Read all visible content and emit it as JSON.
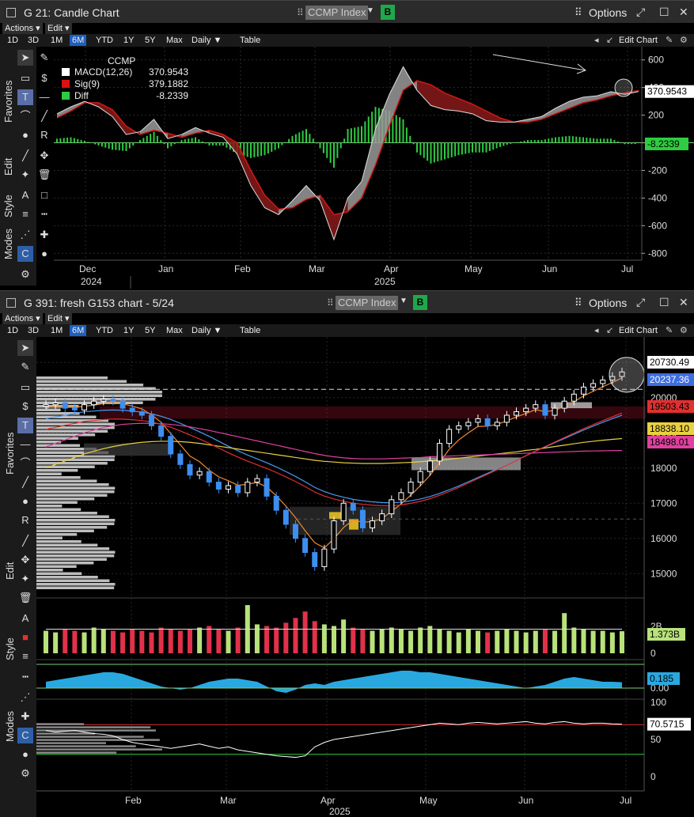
{
  "top_window": {
    "title": "G 21: Candle Chart",
    "security": "CCMP Index",
    "security_button": "B",
    "options_label": "Options",
    "menu": [
      "Actions ▾",
      "Edit ▾"
    ],
    "ranges": [
      "1D",
      "3D",
      "1M",
      "6M",
      "YTD",
      "1Y",
      "5Y",
      "Max",
      "Daily ▼",
      "Table"
    ],
    "selected_range": "6M",
    "edit_chart_label": "Edit Chart",
    "side_labels": [
      "Favorites",
      "Edit",
      "Style",
      "Modes"
    ]
  },
  "bottom_window": {
    "title": "G 391: fresh G153 chart - 5/24",
    "security": "CCMP Index",
    "security_button": "B",
    "options_label": "Options",
    "menu": [
      "Actions ▾",
      "Edit ▾"
    ],
    "ranges": [
      "1D",
      "3D",
      "1M",
      "6M",
      "YTD",
      "1Y",
      "5Y",
      "Max",
      "Daily ▼",
      "Table"
    ],
    "selected_range": "6M",
    "edit_chart_label": "Edit Chart",
    "side_labels": [
      "Favorites",
      "Edit",
      "Style",
      "Modes"
    ]
  },
  "colors": {
    "macd_line": "#ffffff",
    "signal_line": "#d01818",
    "diff_bar": "#2ecc40",
    "ma_red": "#e03030",
    "ma_orange": "#f08a30",
    "ma_blue": "#4a9af0",
    "ma_yellow": "#e8d040",
    "ma_pink": "#e040a0",
    "up_candle": "#ffffff",
    "down_candle": "#3d8ef0",
    "vol_up": "#b8e27a",
    "vol_down": "#e0324a",
    "osc_fill": "#29a8e0",
    "rsi_line": "#ffffff"
  },
  "chart_data": [
    {
      "type": "line",
      "title": "CCMP",
      "legend": [
        {
          "name": "MACD(12,26)",
          "value": "370.9543",
          "color": "#ffffff"
        },
        {
          "name": "Sig(9)",
          "value": "379.1882",
          "color": "#e01010"
        },
        {
          "name": "Diff",
          "value": "-8.2339",
          "color": "#2ecc40"
        }
      ],
      "y_ticks": [
        "600",
        "400",
        "200",
        "0",
        "-200",
        "-400",
        "-600",
        "-800"
      ],
      "ylim": [
        -850,
        650
      ],
      "x_ticks": [
        "Dec",
        "Jan",
        "Feb",
        "Mar",
        "Apr",
        "May",
        "Jun",
        "Jul"
      ],
      "x_years": [
        "2024",
        "2025"
      ],
      "last_labels": [
        "370.9543",
        "-8.2339"
      ],
      "x": [
        0,
        5,
        10,
        15,
        20,
        25,
        30,
        35,
        40,
        45,
        50,
        55,
        60,
        65,
        70,
        75,
        80,
        85,
        90,
        95,
        100,
        105,
        110,
        115,
        120,
        125,
        130,
        135,
        140,
        145,
        150,
        155,
        160,
        165,
        170,
        175,
        180,
        185,
        190,
        195,
        200,
        205,
        210
      ],
      "series": [
        {
          "name": "MACD(12,26)",
          "values": [
            210,
            260,
            300,
            260,
            190,
            60,
            80,
            170,
            30,
            60,
            110,
            70,
            40,
            -80,
            -310,
            -470,
            -520,
            -420,
            -310,
            -420,
            -700,
            -400,
            -280,
            100,
            350,
            550,
            380,
            270,
            240,
            230,
            210,
            160,
            150,
            150,
            170,
            190,
            250,
            300,
            330,
            340,
            370,
            350,
            371
          ]
        },
        {
          "name": "Sig(9)",
          "values": [
            180,
            230,
            290,
            290,
            240,
            120,
            60,
            90,
            70,
            40,
            70,
            90,
            60,
            0,
            -200,
            -380,
            -480,
            -470,
            -410,
            -380,
            -520,
            -500,
            -400,
            -160,
            120,
            380,
            450,
            420,
            360,
            320,
            280,
            230,
            180,
            150,
            150,
            170,
            210,
            250,
            290,
            310,
            340,
            360,
            379
          ]
        },
        {
          "name": "Diff",
          "values": [
            30,
            40,
            15,
            -20,
            -50,
            -60,
            20,
            80,
            -40,
            20,
            40,
            -20,
            -20,
            -80,
            -110,
            -90,
            -40,
            50,
            100,
            -40,
            -180,
            100,
            120,
            260,
            230,
            170,
            -70,
            -150,
            -120,
            -90,
            -70,
            -70,
            -30,
            0,
            20,
            20,
            40,
            50,
            40,
            30,
            30,
            -10,
            -8
          ]
        }
      ]
    },
    {
      "type": "line",
      "y_ticks": [
        "21000",
        "20000",
        "19000",
        "18000",
        "17000",
        "16000",
        "15000"
      ],
      "ylim": [
        14400,
        21500
      ],
      "x_ticks": [
        "Feb",
        "Mar",
        "Apr",
        "May",
        "Jun",
        "Jul"
      ],
      "x_years": [
        "2025"
      ],
      "last_labels": [
        "20730.49",
        "20237.36",
        "19503.43",
        "18838.10",
        "18498.01"
      ],
      "series": [
        {
          "name": "Close",
          "values": [
            19800,
            19850,
            19700,
            19650,
            19800,
            19900,
            19950,
            19900,
            19700,
            19600,
            19500,
            19200,
            18900,
            18400,
            18100,
            17800,
            17900,
            17600,
            17400,
            17500,
            17300,
            17600,
            17700,
            17200,
            16800,
            16400,
            16000,
            15600,
            15200,
            15700,
            16500,
            17000,
            16800,
            16300,
            16500,
            16700,
            17100,
            17300,
            17600,
            17900,
            18200,
            18700,
            19100,
            19200,
            19300,
            19400,
            19200,
            19300,
            19500,
            19600,
            19700,
            19800,
            19500,
            19700,
            19900,
            20100,
            20300,
            20400,
            20500,
            20600,
            20730
          ]
        },
        {
          "name": "MA fast",
          "values": [
            19700,
            19760,
            19760,
            19730,
            19750,
            19790,
            19830,
            19860,
            19820,
            19760,
            19680,
            19510,
            19300,
            18980,
            18660,
            18340,
            18180,
            17940,
            17750,
            17640,
            17510,
            17540,
            17590,
            17460,
            17210,
            16920,
            16590,
            16220,
            15880,
            15730,
            15990,
            16310,
            16520,
            16460,
            16480,
            16560,
            16770,
            16980,
            17230,
            17500,
            17790,
            18160,
            18530,
            18800,
            19000,
            19180,
            19190,
            19240,
            19340,
            19450,
            19550,
            19660,
            19600,
            19640,
            19750,
            19880,
            20050,
            20180,
            20310,
            20430,
            20560
          ]
        },
        {
          "name": "MA 50",
          "values": [
            19400,
            19450,
            19500,
            19550,
            19600,
            19620,
            19640,
            19650,
            19640,
            19620,
            19590,
            19540,
            19470,
            19380,
            19270,
            19150,
            19030,
            18900,
            18760,
            18620,
            18490,
            18370,
            18260,
            18150,
            18030,
            17900,
            17760,
            17610,
            17450,
            17330,
            17240,
            17170,
            17110,
            17070,
            17040,
            17020,
            17010,
            17030,
            17070,
            17120,
            17190,
            17280,
            17380,
            17490,
            17610,
            17730,
            17850,
            17970,
            18090,
            18220,
            18350,
            18480,
            18600,
            18720,
            18840,
            18960,
            19080,
            19190,
            19300,
            19400,
            19503
          ]
        },
        {
          "name": "MA 100",
          "values": [
            18000,
            18100,
            18200,
            18300,
            18400,
            18480,
            18550,
            18610,
            18660,
            18700,
            18730,
            18750,
            18760,
            18760,
            18750,
            18730,
            18700,
            18660,
            18620,
            18580,
            18540,
            18500,
            18460,
            18420,
            18380,
            18340,
            18300,
            18260,
            18220,
            18190,
            18170,
            18150,
            18140,
            18130,
            18130,
            18130,
            18140,
            18150,
            18160,
            18180,
            18200,
            18220,
            18250,
            18280,
            18310,
            18340,
            18370,
            18400,
            18430,
            18460,
            18500,
            18530,
            18570,
            18610,
            18650,
            18690,
            18730,
            18760,
            18790,
            18815,
            18838
          ]
        },
        {
          "name": "MA 200",
          "values": [
            18600,
            18700,
            18800,
            18900,
            19000,
            19080,
            19150,
            19200,
            19240,
            19260,
            19270,
            19270,
            19260,
            19240,
            19210,
            19170,
            19120,
            19070,
            19010,
            18950,
            18890,
            18830,
            18770,
            18710,
            18650,
            18590,
            18530,
            18470,
            18410,
            18360,
            18320,
            18290,
            18270,
            18260,
            18260,
            18260,
            18270,
            18280,
            18290,
            18300,
            18320,
            18330,
            18340,
            18350,
            18360,
            18370,
            18380,
            18390,
            18400,
            18410,
            18420,
            18430,
            18440,
            18450,
            18460,
            18470,
            18480,
            18485,
            18490,
            18495,
            18498
          ]
        }
      ]
    },
    {
      "type": "bar",
      "y_ticks": [
        "2B",
        "0"
      ],
      "last_labels": [
        "1.373B"
      ],
      "values": [
        1.4,
        1.3,
        1.5,
        1.4,
        1.3,
        1.6,
        1.5,
        1.4,
        1.3,
        1.5,
        1.4,
        1.3,
        1.6,
        1.5,
        1.4,
        1.5,
        1.6,
        1.7,
        1.5,
        1.4,
        1.6,
        3.0,
        1.8,
        1.7,
        1.6,
        1.9,
        2.2,
        2.6,
        2.0,
        1.8,
        1.7,
        2.1,
        1.6,
        1.5,
        1.4,
        1.5,
        1.6,
        1.5,
        1.4,
        1.6,
        1.7,
        1.5,
        1.4,
        1.3,
        1.5,
        1.4,
        1.3,
        1.4,
        1.5,
        1.4,
        1.3,
        1.4,
        1.5,
        1.4,
        2.5,
        1.6,
        1.5,
        1.4,
        1.4,
        1.3,
        1.373
      ]
    },
    {
      "type": "area",
      "y_ticks": [
        "0.00"
      ],
      "last_labels": [
        "0.185"
      ],
      "values": [
        0.2,
        0.25,
        0.3,
        0.35,
        0.4,
        0.45,
        0.5,
        0.5,
        0.45,
        0.35,
        0.25,
        0.15,
        0.05,
        0.0,
        -0.05,
        0.0,
        0.1,
        0.2,
        0.25,
        0.3,
        0.3,
        0.25,
        0.2,
        0.05,
        -0.1,
        -0.15,
        -0.05,
        0.1,
        0.15,
        0.1,
        0.2,
        0.25,
        0.3,
        0.35,
        0.4,
        0.45,
        0.5,
        0.55,
        0.55,
        0.5,
        0.5,
        0.45,
        0.4,
        0.35,
        0.3,
        0.25,
        0.2,
        0.15,
        0.1,
        0.05,
        0.0,
        0.05,
        0.1,
        0.2,
        0.3,
        0.35,
        0.3,
        0.25,
        0.2,
        0.2,
        0.185
      ]
    },
    {
      "type": "line",
      "y_ticks": [
        "100",
        "50",
        "0"
      ],
      "last_labels": [
        "70.5715"
      ],
      "values": [
        62,
        60,
        61,
        62,
        60,
        58,
        57,
        55,
        50,
        46,
        44,
        42,
        40,
        38,
        40,
        42,
        44,
        41,
        38,
        40,
        36,
        34,
        32,
        30,
        28,
        27,
        26,
        28,
        40,
        46,
        50,
        52,
        54,
        56,
        58,
        60,
        62,
        64,
        66,
        68,
        70,
        72,
        71,
        70,
        72,
        73,
        72,
        71,
        72,
        73,
        74,
        72,
        71,
        73,
        74,
        72,
        71,
        72,
        72,
        71,
        70.5715
      ]
    }
  ]
}
